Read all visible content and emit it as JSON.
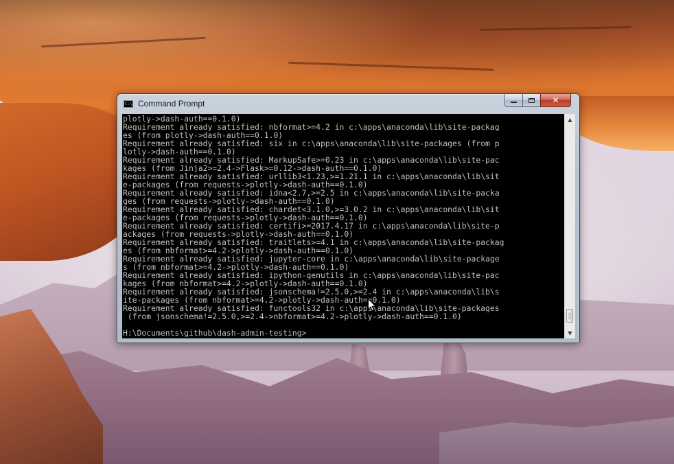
{
  "window": {
    "title": "Command Prompt",
    "icon": "cmd-icon",
    "icon_text": "C:\\"
  },
  "console": {
    "lines": [
      "plotly->dash-auth==0.1.0)",
      "Requirement already satisfied: nbformat>=4.2 in c:\\apps\\anaconda\\lib\\site-packag",
      "es (from plotly->dash-auth==0.1.0)",
      "Requirement already satisfied: six in c:\\apps\\anaconda\\lib\\site-packages (from p",
      "lotly->dash-auth==0.1.0)",
      "Requirement already satisfied: MarkupSafe>=0.23 in c:\\apps\\anaconda\\lib\\site-pac",
      "kages (from Jinja2>=2.4->Flask>=0.12->dash-auth==0.1.0)",
      "Requirement already satisfied: urllib3<1.23,>=1.21.1 in c:\\apps\\anaconda\\lib\\sit",
      "e-packages (from requests->plotly->dash-auth==0.1.0)",
      "Requirement already satisfied: idna<2.7,>=2.5 in c:\\apps\\anaconda\\lib\\site-packa",
      "ges (from requests->plotly->dash-auth==0.1.0)",
      "Requirement already satisfied: chardet<3.1.0,>=3.0.2 in c:\\apps\\anaconda\\lib\\sit",
      "e-packages (from requests->plotly->dash-auth==0.1.0)",
      "Requirement already satisfied: certifi>=2017.4.17 in c:\\apps\\anaconda\\lib\\site-p",
      "ackages (from requests->plotly->dash-auth==0.1.0)",
      "Requirement already satisfied: traitlets>=4.1 in c:\\apps\\anaconda\\lib\\site-packag",
      "es (from nbformat>=4.2->plotly->dash-auth==0.1.0)",
      "Requirement already satisfied: jupyter-core in c:\\apps\\anaconda\\lib\\site-package",
      "s (from nbformat>=4.2->plotly->dash-auth==0.1.0)",
      "Requirement already satisfied: ipython-genutils in c:\\apps\\anaconda\\lib\\site-pac",
      "kages (from nbformat>=4.2->plotly->dash-auth==0.1.0)",
      "Requirement already satisfied: jsonschema!=2.5.0,>=2.4 in c:\\apps\\anaconda\\lib\\s",
      "ite-packages (from nbformat>=4.2->plotly->dash-auth==0.1.0)",
      "Requirement already satisfied: functools32 in c:\\apps\\anaconda\\lib\\site-packages",
      " (from jsonschema!=2.5.0,>=2.4->nbformat>=4.2->plotly->dash-auth==0.1.0)",
      "",
      "H:\\Documents\\github\\dash-admin-testing>"
    ]
  },
  "colors": {
    "console_background": "#000000",
    "console_text": "#c0c0c0",
    "close_button": "#c0432f"
  },
  "icons": {
    "minimize": "minimize-icon",
    "maximize": "maximize-icon",
    "close": "close-icon",
    "scroll_up": "scroll-up-arrow-icon",
    "scroll_down": "scroll-down-arrow-icon",
    "mouse_cursor": "mouse-pointer-icon"
  }
}
